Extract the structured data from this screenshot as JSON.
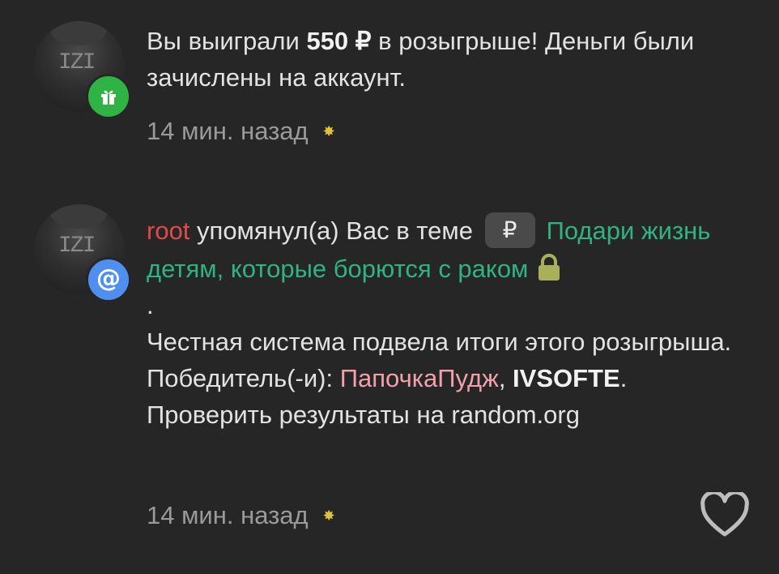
{
  "notifications": [
    {
      "avatar_text": "IZI",
      "badge_icon": "gift-icon",
      "badge_color": "#2fb344",
      "text_before": "Вы выиграли ",
      "amount": "550 ₽",
      "text_after": " в розыгрыше! Деньги были зачислены на аккаунт.",
      "time": "14 мин. назад"
    },
    {
      "avatar_text": "IZI",
      "badge_icon": "at-icon",
      "badge_glyph": "@",
      "badge_color": "#4f8ff0",
      "username": "root",
      "mention_text": " упомянул(а) Вас в теме ",
      "prefix_badge": "₽",
      "thread_title": "Подари жизнь детям, которые борются с раком",
      "dot": ".",
      "body_1": "Честная система подвела итоги этого розыгрыша. Победитель(-и): ",
      "winner_1": "ПапочкаПудж",
      "sep": ", ",
      "winner_2": "IVSOFTE",
      "body_2": ". Проверить результаты на random.org",
      "time": "14 мин. назад"
    }
  ],
  "colors": {
    "background": "#262626",
    "username_red": "#e14a4a",
    "winner_pink": "#f2a0ae",
    "link_green": "#2fb383",
    "lock_olive": "#a9b05a"
  }
}
